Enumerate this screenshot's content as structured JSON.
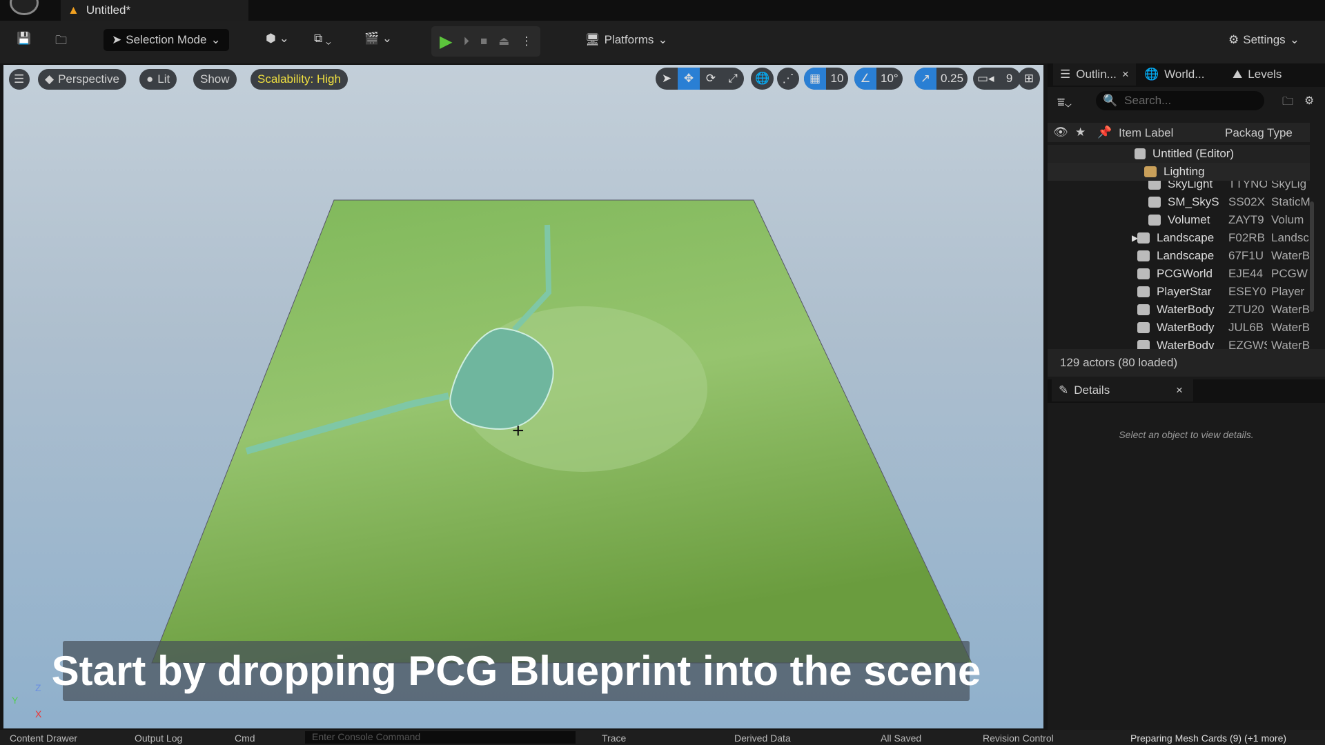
{
  "window": {
    "tab_title": "Untitled*"
  },
  "toolbar": {
    "mode": "Selection Mode",
    "platforms": "Platforms",
    "settings": "Settings"
  },
  "viewport": {
    "perspective": "Perspective",
    "lit": "Lit",
    "show": "Show",
    "scalability": "Scalability: High",
    "grid_snap": "10",
    "rotation_snap": "10°",
    "scale_snap": "0.25",
    "camera_speed": "9",
    "axis": {
      "z": "Z",
      "y": "Y",
      "x": "X"
    }
  },
  "subtitle": "Start by dropping PCG Blueprint into the scene",
  "outliner": {
    "tabs": [
      "Outlin...",
      "World...",
      "Levels"
    ],
    "search_placeholder": "Search...",
    "columns": {
      "label": "Item Label",
      "package": "Packag",
      "type": "Type"
    },
    "root": "Untitled (Editor)",
    "folder": "Lighting",
    "rows": [
      {
        "label": "SkyLight",
        "package": "TTYNOI",
        "type": "SkyLig"
      },
      {
        "label": "SM_SkyS",
        "package": "SS02X",
        "type": "StaticM"
      },
      {
        "label": "Volumet",
        "package": "ZAYT9",
        "type": "Volum"
      },
      {
        "label": "Landscape",
        "package": "F02RB",
        "type": "Landsc"
      },
      {
        "label": "Landscape",
        "package": "67F1U",
        "type": "WaterB"
      },
      {
        "label": "PCGWorld",
        "package": "EJE44",
        "type": "PCGW"
      },
      {
        "label": "PlayerStar",
        "package": "ESEY0",
        "type": "Player"
      },
      {
        "label": "WaterBody",
        "package": "ZTU20",
        "type": "WaterB"
      },
      {
        "label": "WaterBody",
        "package": "JUL6B",
        "type": "WaterB"
      },
      {
        "label": "WaterBody",
        "package": "EZGWS",
        "type": "WaterB"
      }
    ],
    "footer": "129 actors (80 loaded)"
  },
  "details": {
    "tab": "Details",
    "empty": "Select an object to view details."
  },
  "statusbar": {
    "content_drawer": "Content Drawer",
    "output_log": "Output Log",
    "cmd": "Cmd",
    "console_placeholder": "Enter Console Command",
    "trace": "Trace",
    "derived_data": "Derived Data",
    "all_saved": "All Saved",
    "revision_control": "Revision Control",
    "progress": "Preparing Mesh Cards (9) (+1 more)"
  }
}
